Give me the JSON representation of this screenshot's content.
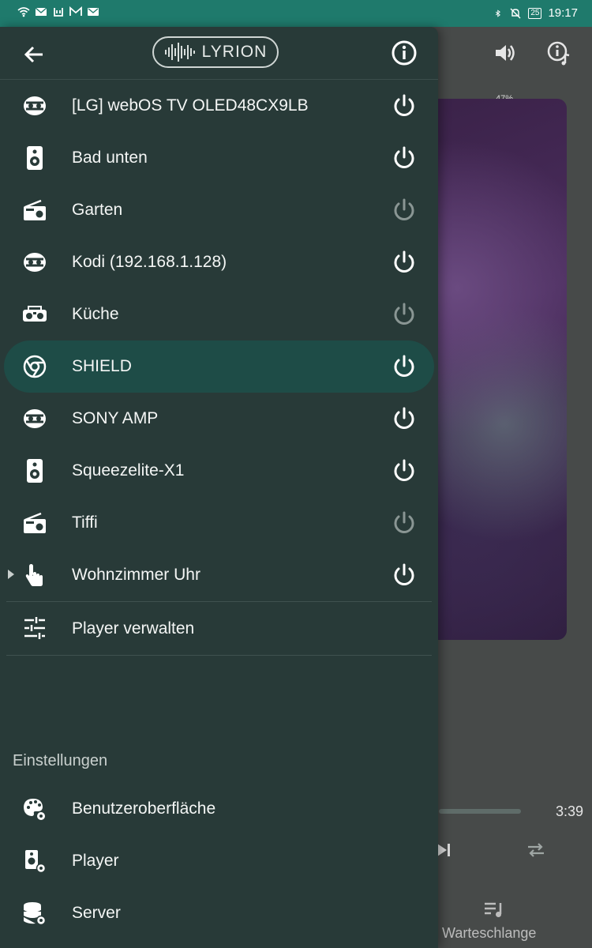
{
  "statusbar": {
    "time": "19:17",
    "battery": "25"
  },
  "header": {
    "logo_text": "LYRION"
  },
  "players": [
    {
      "name": "[LG] webOS TV OLED48CX9LB",
      "icon": "cast-icon",
      "power": "on"
    },
    {
      "name": "Bad unten",
      "icon": "speaker-icon",
      "power": "on"
    },
    {
      "name": "Garten",
      "icon": "radio-icon",
      "power": "off"
    },
    {
      "name": "Kodi (192.168.1.128)",
      "icon": "cast-icon",
      "power": "on"
    },
    {
      "name": "Küche",
      "icon": "boombox-icon",
      "power": "off"
    },
    {
      "name": "SHIELD",
      "icon": "chrome-icon",
      "power": "on",
      "selected": true
    },
    {
      "name": "SONY AMP",
      "icon": "cast-icon",
      "power": "on"
    },
    {
      "name": "Squeezelite-X1",
      "icon": "speaker-icon",
      "power": "on"
    },
    {
      "name": "Tiffi",
      "icon": "radio-icon",
      "power": "off"
    },
    {
      "name": "Wohnzimmer Uhr",
      "icon": "touch-icon",
      "power": "on",
      "expandable": true
    }
  ],
  "manage": {
    "label": "Player verwalten",
    "icon": "sliders-icon"
  },
  "settings": {
    "header": "Einstellungen",
    "items": [
      {
        "label": "Benutzeroberfläche",
        "icon": "palette-gear-icon"
      },
      {
        "label": "Player",
        "icon": "player-gear-icon"
      },
      {
        "label": "Server",
        "icon": "database-gear-icon"
      }
    ]
  },
  "background": {
    "volume": "47%",
    "track_time": "3:39",
    "queue_label": "Warteschlange"
  },
  "colors": {
    "statusbar": "#1f7a6c",
    "drawer": "#283a38",
    "selected": "#1e4c47",
    "power_on": "#ffffff",
    "power_off": "#8a9694"
  }
}
